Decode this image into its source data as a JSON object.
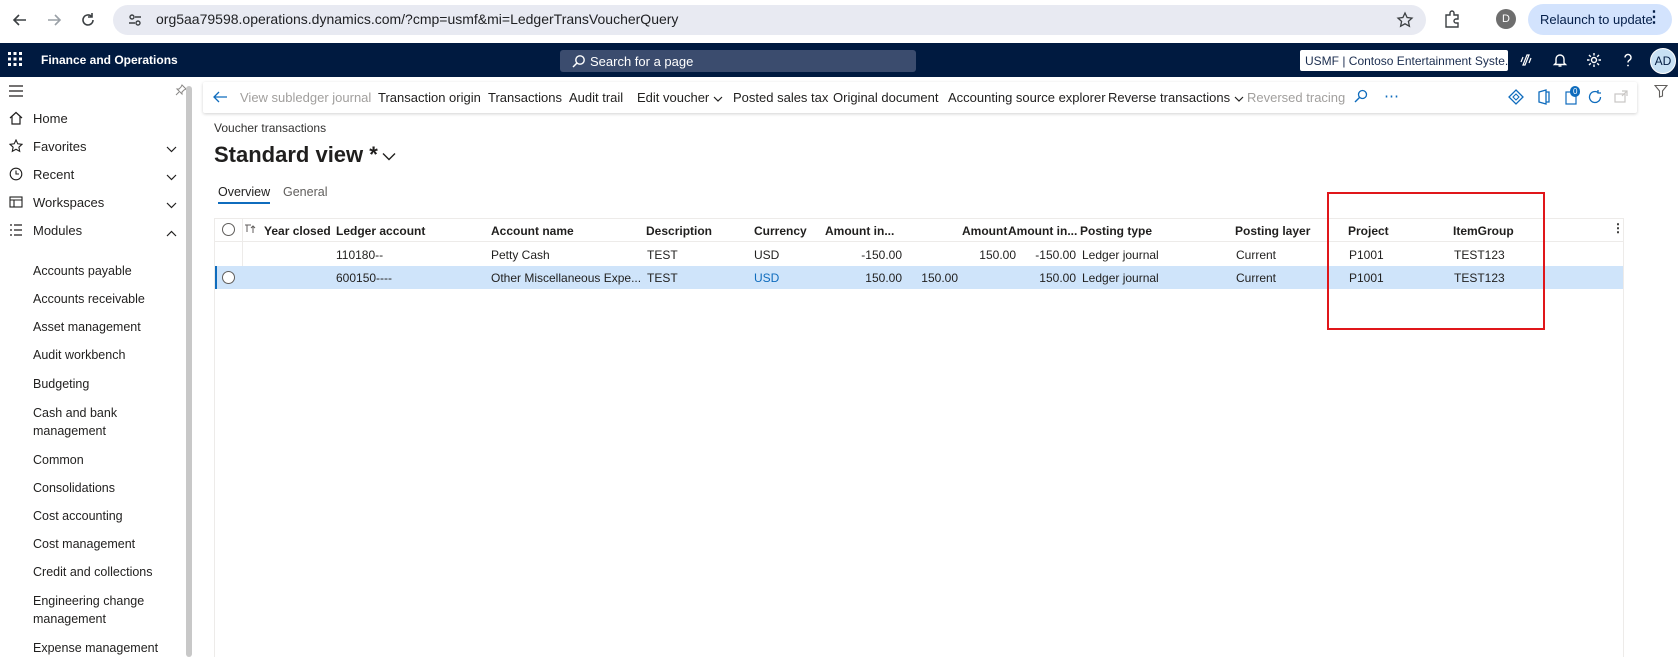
{
  "browser": {
    "url": "org5aa79598.operations.dynamics.com/?cmp=usmf&mi=LedgerTransVoucherQuery",
    "profile_initial": "D",
    "relaunch_label": "Relaunch to update"
  },
  "header": {
    "app_name": "Finance and Operations",
    "search_placeholder": "Search for a page",
    "company": "USMF | Contoso Entertainment Syste...",
    "user_initials": "AD"
  },
  "leftnav": {
    "top_items": [
      {
        "label": "Home"
      },
      {
        "label": "Favorites"
      },
      {
        "label": "Recent"
      },
      {
        "label": "Workspaces"
      },
      {
        "label": "Modules"
      }
    ],
    "modules": [
      "Accounts payable",
      "Accounts receivable",
      "Asset management",
      "Audit workbench",
      "Budgeting",
      "Cash and bank management",
      "Common",
      "Consolidations",
      "Cost accounting",
      "Cost management",
      "Credit and collections",
      "Engineering change management",
      "Expense management"
    ]
  },
  "actionpane": {
    "items": [
      {
        "label": "View subledger journal",
        "disabled": true
      },
      {
        "label": "Transaction origin"
      },
      {
        "label": "Transactions"
      },
      {
        "label": "Audit trail"
      },
      {
        "label": "Edit voucher"
      },
      {
        "label": "Posted sales tax"
      },
      {
        "label": "Original document"
      },
      {
        "label": "Accounting source explorer"
      },
      {
        "label": "Reverse transactions"
      },
      {
        "label": "Reversed tracing",
        "disabled": true
      }
    ],
    "badge_count": "0"
  },
  "page": {
    "breadcrumb": "Voucher transactions",
    "view_name": "Standard view *",
    "tabs": [
      "Overview",
      "General"
    ]
  },
  "grid": {
    "columns": [
      "Year closed",
      "Ledger account",
      "Account name",
      "Description",
      "Currency",
      "Amount in...",
      "Amount",
      "Amount in...",
      "Posting type",
      "Posting layer",
      "Project",
      "ItemGroup"
    ],
    "rows": [
      {
        "ledger_account": "110180--",
        "account_name": "Petty Cash",
        "description": "TEST",
        "currency": "USD",
        "amount_in_1": "-150.00",
        "amount_extra": "",
        "amount": "150.00",
        "amount_in_2": "-150.00",
        "posting_type": "Ledger journal",
        "posting_layer": "Current",
        "project": "P1001",
        "item_group": "TEST123"
      },
      {
        "ledger_account": "600150----",
        "account_name": "Other Miscellaneous Expe...",
        "description": "TEST",
        "currency": "USD",
        "amount_in_1": "150.00",
        "amount_extra": "150.00",
        "amount": "",
        "amount_in_2": "150.00",
        "posting_type": "Ledger journal",
        "posting_layer": "Current",
        "project": "P1001",
        "item_group": "TEST123"
      }
    ]
  },
  "colors": {
    "header_bg": "#001a40",
    "accent": "#0f6cbd",
    "selected_row": "#cfe4fa",
    "highlight": "#e0161a"
  }
}
